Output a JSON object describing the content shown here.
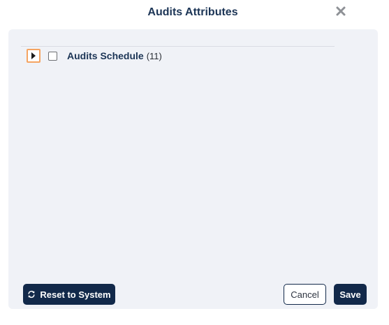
{
  "dialog": {
    "title": "Audits Attributes",
    "close_icon": "close-icon"
  },
  "tree": {
    "nodes": [
      {
        "label": "Audits Schedule",
        "count": "(11)",
        "expanded": false,
        "checked": false,
        "toggle_icon": "caret-right-icon"
      }
    ]
  },
  "footer": {
    "reset_label": "Reset to System",
    "reset_icon": "refresh-icon",
    "cancel_label": "Cancel",
    "save_label": "Save"
  },
  "colors": {
    "title": "#1c3556",
    "primary_button": "#12294a",
    "panel_background": "#f0f2f7",
    "focus_outline": "#f5a462"
  }
}
